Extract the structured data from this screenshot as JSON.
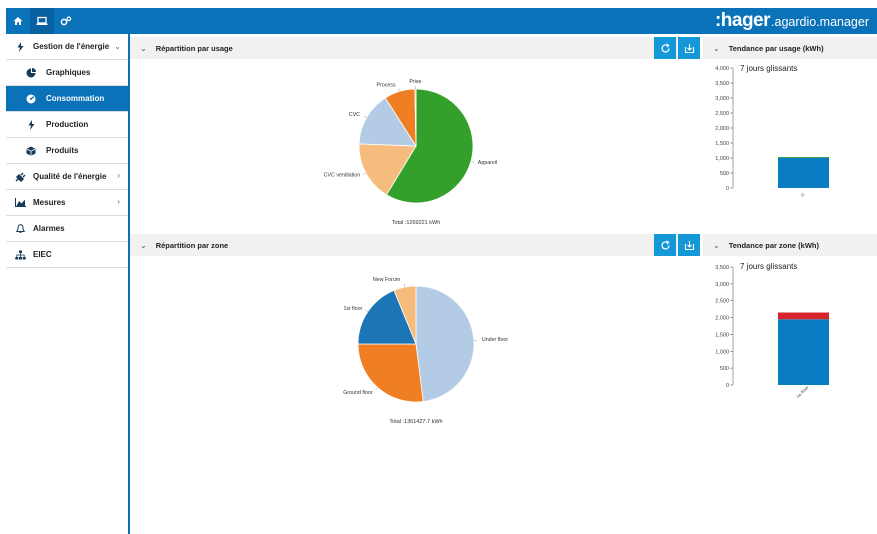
{
  "brand": {
    "name": ":hager",
    "product": ".agardio.manager"
  },
  "topbar": {
    "icons": [
      "home-icon",
      "laptop-icon",
      "gears-icon"
    ]
  },
  "sidebar": {
    "items": [
      {
        "label": "Gestion de l'énergie",
        "icon": "bolt-icon",
        "expanded": true
      },
      {
        "label": "Graphiques",
        "icon": "pie-icon",
        "sub": true
      },
      {
        "label": "Consommation",
        "icon": "gauge-icon",
        "sub": true,
        "active": true
      },
      {
        "label": "Production",
        "icon": "bolt-icon",
        "sub": true
      },
      {
        "label": "Produits",
        "icon": "cube-icon",
        "sub": true
      },
      {
        "label": "Qualité de l'énergie",
        "icon": "plug-icon"
      },
      {
        "label": "Mesures",
        "icon": "area-chart-icon"
      },
      {
        "label": "Alarmes",
        "icon": "bell-icon"
      },
      {
        "label": "EIEC",
        "icon": "sitemap-icon"
      }
    ]
  },
  "usage_panel": {
    "title": "Répartition par usage",
    "total": "Total :1269221 kWh"
  },
  "usage_trend": {
    "title": "Tendance par usage (kWh)",
    "subtitle": "7 jours glissants"
  },
  "zone_panel": {
    "title": "Répartition par zone",
    "total": "Total :1361427.7 kWh"
  },
  "zone_trend": {
    "title": "Tendance par zone (kWh)",
    "subtitle": "7 jours glissants"
  },
  "chart_data": [
    {
      "type": "pie",
      "title": "Répartition par usage",
      "colors": [
        "#3a9d2c",
        "#f6bc7d",
        "#b1cae6",
        "#ef7f22"
      ],
      "categories": [
        "Appareil",
        "CVC ventilation",
        "CVC",
        "Process",
        "Prise"
      ],
      "values": [
        57.2,
        16.5,
        15.0,
        8.5,
        0.3
      ],
      "slice_colors": [
        "#34a02c",
        "#f6bc7d",
        "#b3cbe5",
        "#ef7f22",
        "#ef7f22"
      ],
      "total_label": "Total :1269221 kWh"
    },
    {
      "type": "bar",
      "title": "Tendance par usage (kWh)",
      "subtitle": "7 jours glissants",
      "categories": [
        "ci"
      ],
      "series": [
        {
          "values": [
            1020
          ],
          "color": "#0a7dc2"
        },
        {
          "values": [
            10
          ],
          "color": "#34a02c"
        }
      ],
      "ylim": [
        0,
        4000
      ],
      "yticks": [
        "0",
        "500",
        "1,000",
        "1,500",
        "2,000",
        "2,500",
        "3,000",
        "3,500",
        "4,000"
      ]
    },
    {
      "type": "pie",
      "title": "Répartition par zone",
      "categories": [
        "Under floor",
        "Ground floor",
        "1st floor",
        "New Forum"
      ],
      "values": [
        48.0,
        27.0,
        18.8,
        6.2
      ],
      "slice_colors": [
        "#b3cbe5",
        "#ef7f22",
        "#1c76b5",
        "#f6bc7d"
      ],
      "total_label": "Total :1361427.7 kWh"
    },
    {
      "type": "bar",
      "title": "Tendance par zone (kWh)",
      "subtitle": "7 jours glissants",
      "categories": [
        "ne floor"
      ],
      "series": [
        {
          "values": [
            1950
          ],
          "color": "#0a7dc2"
        },
        {
          "values": [
            200
          ],
          "color": "#d6242a"
        }
      ],
      "ylim": [
        0,
        3500
      ],
      "yticks": [
        "0",
        "500",
        "1,000",
        "1,500",
        "2,000",
        "2,500",
        "3,000",
        "3,500"
      ]
    }
  ]
}
